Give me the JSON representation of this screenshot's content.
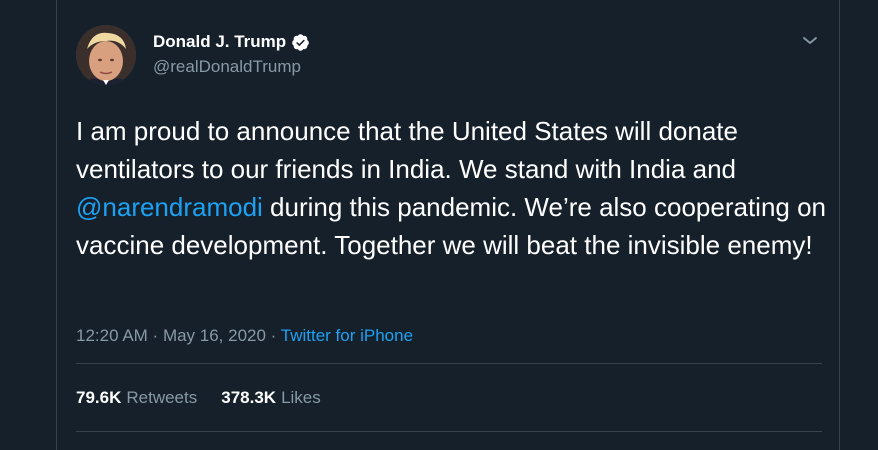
{
  "user": {
    "display_name": "Donald J. Trump",
    "handle": "@realDonaldTrump",
    "verified": true
  },
  "tweet": {
    "text_before": "I am proud to announce that the United States will donate ventilators to our friends in India. We stand with India and ",
    "mention": "@narendramodi",
    "text_after": " during this pandemic. We’re also cooperating on vaccine development. Together we will beat the invisible enemy!"
  },
  "meta": {
    "time": "12:20 AM",
    "separator": " · ",
    "date": "May 16, 2020",
    "source": "Twitter for iPhone"
  },
  "stats": {
    "retweets_count": "79.6K",
    "retweets_label": "Retweets",
    "likes_count": "378.3K",
    "likes_label": "Likes"
  },
  "icons": {
    "verified": "verified-badge-icon",
    "menu": "chevron-down-icon"
  },
  "colors": {
    "background": "#15202b",
    "accent": "#1da1f2",
    "secondary_text": "#8899a6",
    "border": "#38444d"
  }
}
